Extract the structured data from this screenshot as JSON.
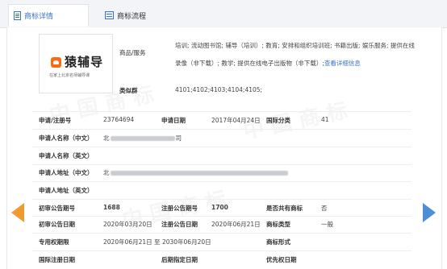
{
  "tabs": [
    {
      "label": "商标详情",
      "active": true
    },
    {
      "label": "商标流程",
      "active": false
    }
  ],
  "logo": {
    "name": "猿辅导",
    "tagline": "在家上北京名师辅导课"
  },
  "goods_services": {
    "label": "商品/服务",
    "text": "培训; 流动图书馆; 辅导（培训）; 教育; 安排和组织培训班; 书籍出版; 娱乐服务; 提供在线录像（非下载）; 教学; 提供在线电子出版物（非下载）;",
    "link": "查看详细信息"
  },
  "similar_group": {
    "label": "类似群",
    "value": "4101;4102;4103;4104;4105;"
  },
  "rows": {
    "reg_no_label": "申请/注册号",
    "reg_no": "23764694",
    "apply_date_label": "申请日期",
    "apply_date": "2017年04月24日",
    "intl_class_label": "国际分类",
    "intl_class": "41",
    "applicant_cn_label": "申请人名称（中文）",
    "applicant_cn_prefix": "北",
    "applicant_cn_suffix": "司",
    "applicant_en_label": "申请人名称（英文）",
    "address_cn_label": "申请人地址（中文）",
    "address_cn_prefix": "北",
    "address_en_label": "申请人地址（英文）",
    "prelim_issue_label": "初审公告期号",
    "prelim_issue": "1688",
    "reg_issue_label": "注册公告期号",
    "reg_issue": "1700",
    "shared_label": "是否共有商标",
    "shared": "否",
    "prelim_date_label": "初审公告日期",
    "prelim_date": "2020年03月20日",
    "reg_date_label": "注册公告日期",
    "reg_date": "2020年06月21日",
    "tm_type_label": "商标类型",
    "tm_type": "一般",
    "exclusive_label": "专用权期限",
    "exclusive": "2020年06月21日 至 2030年06月20日",
    "tm_form_label": "商标形式",
    "intl_reg_date_label": "国际注册日期",
    "later_date_label": "后期指定日期",
    "priority_date_label": "优先权日期"
  },
  "colors": {
    "accent": "#3a74c7",
    "prev_arrow": "#f09a32",
    "next_arrow": "#4d8fd6",
    "logo_orange": "#ff6a10"
  }
}
